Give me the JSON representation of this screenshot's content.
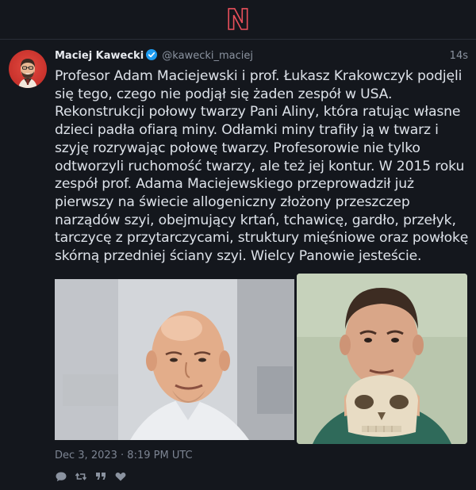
{
  "app": {
    "logo_text": "N",
    "logo_color": "#e8505b"
  },
  "tweet": {
    "author_name": "Maciej Kawecki",
    "handle": "@kawecki_maciej",
    "time_ago": "14s",
    "verified": true,
    "text": "Profesor Adam Maciejewski i prof. Łukasz Krakowczyk podjęli się tego, czego nie podjął się żaden zespół w USA. Rekonstrukcji połowy twarzy Pani Aliny, która ratując własne dzieci padła ofiarą miny. Odłamki miny trafiły ją w twarz i szyję rozrywając połowę twarzy. Profesorowie nie tylko odtworzyli ruchomość twarzy, ale też jej kontur. W 2015 roku zespół prof. Adama Maciejewskiego przeprowadził już pierwszy na świecie allogeniczny złożony przeszczep narządów szyi, obejmujący krtań, tchawicę, gardło, przełyk, tarczycę z przytarczycami, struktury mięśniowe oraz powłokę skórną przedniej ściany szyi. Wielcy Panowie jesteście.",
    "timestamp": "Dec 3, 2023 · 8:19 PM UTC",
    "media": [
      {
        "kind": "photo",
        "icon": "photo-bald-man"
      },
      {
        "kind": "photo",
        "icon": "photo-man-with-skull-model"
      }
    ],
    "actions": [
      {
        "name": "reply",
        "icon": "speech-bubble-icon"
      },
      {
        "name": "retweet",
        "icon": "retweet-icon"
      },
      {
        "name": "quote",
        "icon": "quote-icon"
      },
      {
        "name": "like",
        "icon": "heart-icon"
      }
    ]
  },
  "colors": {
    "background": "#14171d",
    "text": "#dde2e9",
    "muted": "#8b93a0",
    "verified": "#1d9bf0"
  }
}
